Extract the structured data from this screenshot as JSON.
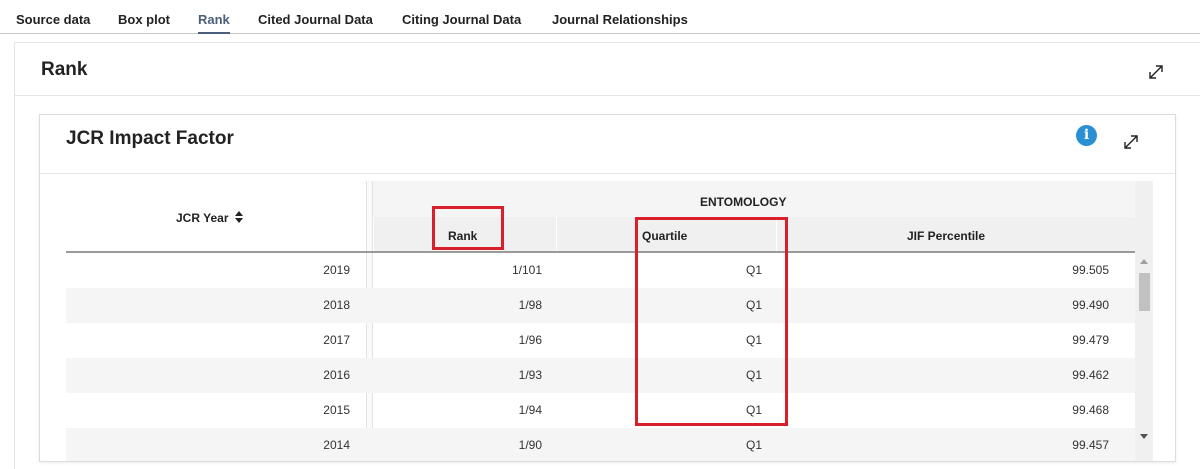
{
  "tabs": [
    {
      "label": "Source data",
      "active": false
    },
    {
      "label": "Box plot",
      "active": false
    },
    {
      "label": "Rank",
      "active": true
    },
    {
      "label": "Cited Journal Data",
      "active": false
    },
    {
      "label": "Citing Journal Data",
      "active": false
    },
    {
      "label": "Journal Relationships",
      "active": false
    }
  ],
  "outer_panel": {
    "title": "Rank"
  },
  "card": {
    "title": "JCR Impact Factor"
  },
  "table": {
    "year_header": "JCR Year",
    "group_header": "ENTOMOLOGY",
    "columns": {
      "rank": "Rank",
      "quartile": "Quartile",
      "percentile": "JIF Percentile"
    },
    "rows": [
      {
        "year": "2019",
        "rank": "1/101",
        "quartile": "Q1",
        "percentile": "99.505"
      },
      {
        "year": "2018",
        "rank": "1/98",
        "quartile": "Q1",
        "percentile": "99.490"
      },
      {
        "year": "2017",
        "rank": "1/96",
        "quartile": "Q1",
        "percentile": "99.479"
      },
      {
        "year": "2016",
        "rank": "1/93",
        "quartile": "Q1",
        "percentile": "99.462"
      },
      {
        "year": "2015",
        "rank": "1/94",
        "quartile": "Q1",
        "percentile": "99.468"
      },
      {
        "year": "2014",
        "rank": "1/90",
        "quartile": "Q1",
        "percentile": "99.457"
      }
    ]
  },
  "icons": {
    "expand": "expand-icon",
    "info": "info-icon",
    "sort": "sort-icon"
  },
  "colors": {
    "accent": "#4a5f7a",
    "info": "#2b8fd4",
    "highlight": "#d9202a"
  }
}
